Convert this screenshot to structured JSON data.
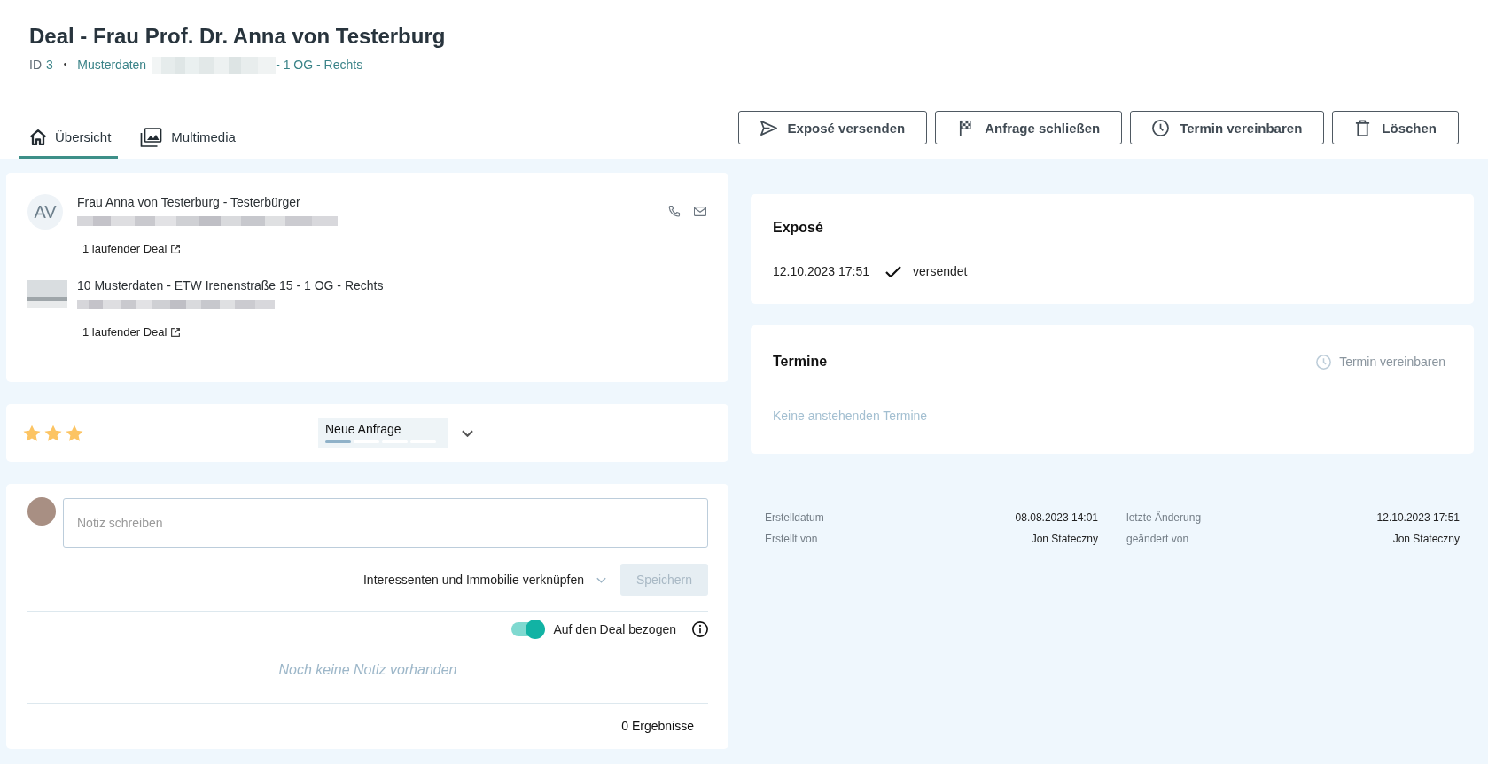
{
  "header": {
    "title": "Deal - Frau Prof. Dr. Anna von Testerburg",
    "id_label": "ID",
    "id_value": "3",
    "separator": "•",
    "property_link_start": "Musterdaten",
    "property_link_end": "- 1 OG - Rechts"
  },
  "tabs": [
    {
      "label": "Übersicht",
      "selected": true
    },
    {
      "label": "Multimedia",
      "selected": false
    }
  ],
  "actions": [
    {
      "label": "Exposé versenden"
    },
    {
      "label": "Anfrage schließen"
    },
    {
      "label": "Termin vereinbaren"
    },
    {
      "label": "Löschen"
    }
  ],
  "contacts": [
    {
      "kind": "person",
      "initials": "AV",
      "name": "Frau Anna von Testerburg - Testerbürger",
      "deals_link": "1 laufender Deal"
    },
    {
      "kind": "property",
      "name": "10 Musterdaten - ETW Irenenstraße 15 - 1 OG - Rechts",
      "deals_link": "1 laufender Deal"
    }
  ],
  "deal_status": {
    "stars": 3,
    "stage": "Neue Anfrage",
    "steps": [
      {
        "done": true
      },
      {
        "done": false
      },
      {
        "done": false
      },
      {
        "done": false
      }
    ]
  },
  "notes": {
    "placeholder": "Notiz schreiben",
    "link_dropdown": "Interessenten und Immobilie verknüpfen",
    "save_button": {
      "label": "Speichern",
      "disabled": true
    },
    "deal_toggle": {
      "label": "Auf den Deal bezogen",
      "on": true
    },
    "empty_text": "Noch keine Notiz vorhanden",
    "result_count": "0 Ergebnisse"
  },
  "expose": {
    "title": "Exposé",
    "date": "12.10.2023 17:51",
    "status": "versendet"
  },
  "appointments": {
    "title": "Termine",
    "action": "Termin vereinbaren",
    "empty_text": "Keine anstehenden Termine"
  },
  "meta": [
    {
      "label": "Erstelldatum",
      "value": "08.08.2023 14:01"
    },
    {
      "label": "letzte Änderung",
      "value": "12.10.2023 17:51"
    },
    {
      "label": "Erstellt von",
      "value": "Jon Stateczny"
    },
    {
      "label": "geändert von",
      "value": "Jon Stateczny"
    }
  ]
}
